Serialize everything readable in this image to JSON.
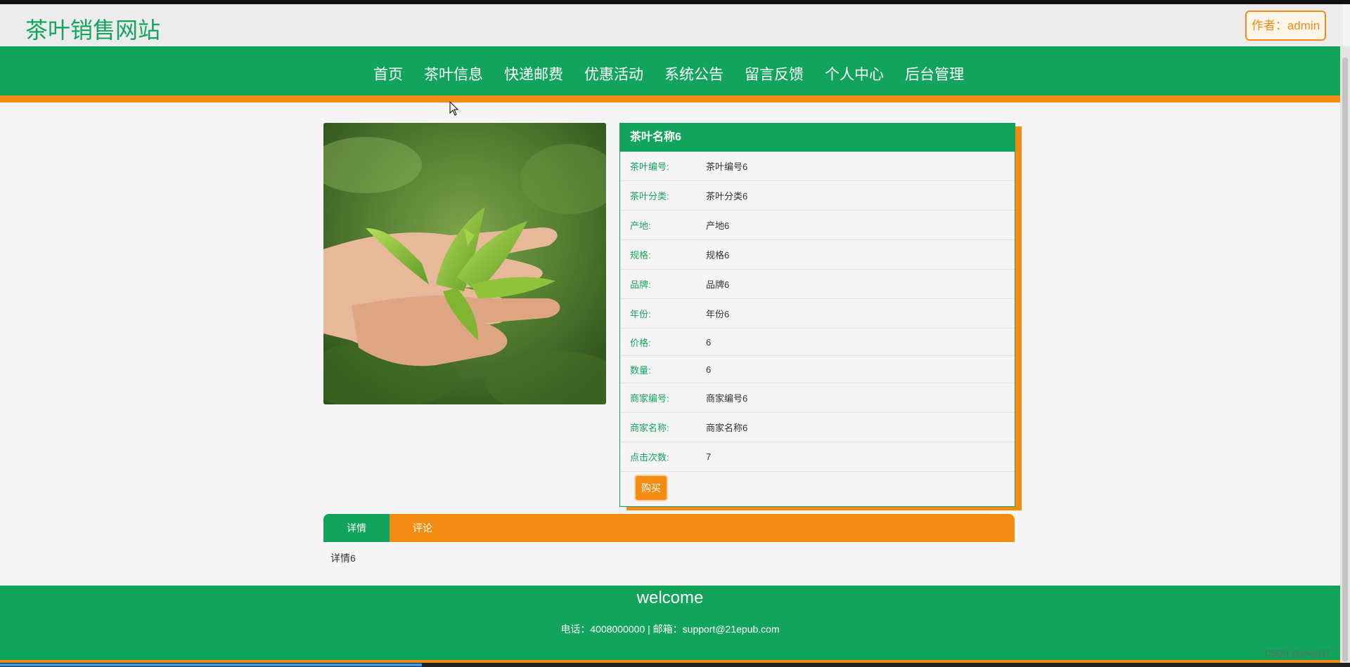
{
  "header": {
    "site_title": "茶叶销售网站",
    "author_label": "作者：admin"
  },
  "nav": {
    "items": [
      "首页",
      "茶叶信息",
      "快递邮费",
      "优惠活动",
      "系统公告",
      "留言反馈",
      "个人中心",
      "后台管理"
    ]
  },
  "product": {
    "title": "茶叶名称6",
    "rows": [
      {
        "label": "茶叶编号:",
        "value": "茶叶编号6"
      },
      {
        "label": "茶叶分类:",
        "value": "茶叶分类6"
      },
      {
        "label": "产地:",
        "value": "产地6"
      },
      {
        "label": "规格:",
        "value": "规格6"
      },
      {
        "label": "品牌:",
        "value": "品牌6"
      },
      {
        "label": "年份:",
        "value": "年份6"
      },
      {
        "label": "价格:",
        "value": "6"
      },
      {
        "label": "数量:",
        "value": "6"
      },
      {
        "label": "商家编号:",
        "value": "商家编号6"
      },
      {
        "label": "商家名称:",
        "value": "商家名称6"
      },
      {
        "label": "点击次数:",
        "value": "7"
      }
    ],
    "buy_label": "购买"
  },
  "tabs": {
    "items": [
      "详情",
      "评论"
    ],
    "detail_text": "详情6"
  },
  "footer": {
    "welcome": "welcome",
    "contact": "电话：4008000000 | 邮箱：support@21epub.com"
  },
  "watermark": "CSDN @sheji117",
  "colors": {
    "primary": "#12a45c",
    "accent": "#f28c12"
  },
  "icons": {
    "cursor": "mouse-pointer-icon"
  }
}
